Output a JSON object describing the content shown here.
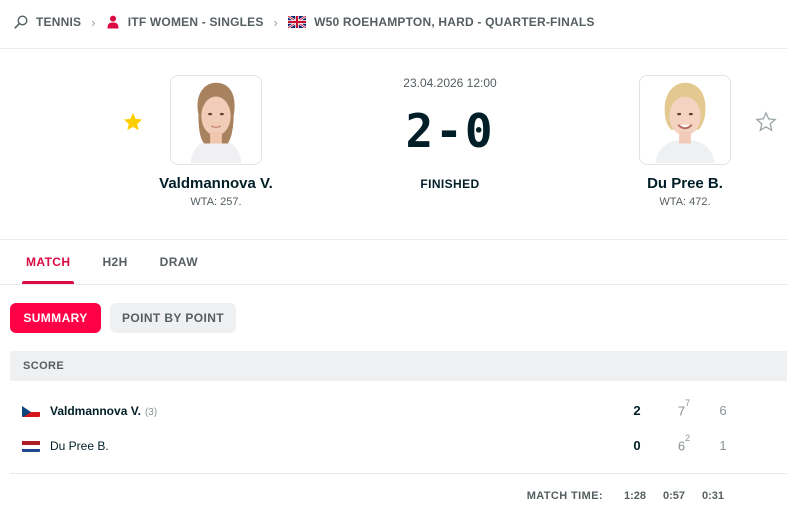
{
  "breadcrumb": [
    {
      "label": "TENNIS",
      "icon": "tennis-racket-icon"
    },
    {
      "label": "ITF WOMEN - SINGLES",
      "icon": "woman-player-icon"
    },
    {
      "label": "W50 ROEHAMPTON, HARD - QUARTER-FINALS",
      "icon": "uk-flag-icon"
    }
  ],
  "match": {
    "datetime": "23.04.2026 12:00",
    "score": "2-0",
    "status": "FINISHED"
  },
  "home": {
    "name": "Valdmannova V.",
    "rank": "WTA: 257.",
    "favorite": true,
    "flag": "czech-flag-icon"
  },
  "away": {
    "name": "Du Pree B.",
    "rank": "WTA: 472.",
    "favorite": false,
    "flag": "netherlands-flag-icon"
  },
  "tabs": [
    "MATCH",
    "H2H",
    "DRAW"
  ],
  "active_tab": "MATCH",
  "subtabs": [
    "SUMMARY",
    "POINT BY POINT"
  ],
  "active_subtab": "SUMMARY",
  "score_section": {
    "header": "SCORE",
    "rows": [
      {
        "name": "Valdmannova V.",
        "seed": "(3)",
        "sets": "2",
        "games": [
          {
            "value": "7",
            "tiebreak": "7"
          },
          {
            "value": "6",
            "tiebreak": ""
          }
        ]
      },
      {
        "name": "Du Pree B.",
        "seed": "",
        "sets": "0",
        "games": [
          {
            "value": "6",
            "tiebreak": "2"
          },
          {
            "value": "1",
            "tiebreak": ""
          }
        ]
      }
    ]
  },
  "match_time": {
    "label": "MATCH TIME:",
    "total": "1:28",
    "sets": [
      "0:57",
      "0:31"
    ]
  },
  "colors": {
    "accent": "#ff0046",
    "accent_text": "#dc0a42",
    "star": "#ffcd00",
    "text": "#001e28",
    "muted": "#555e61"
  }
}
